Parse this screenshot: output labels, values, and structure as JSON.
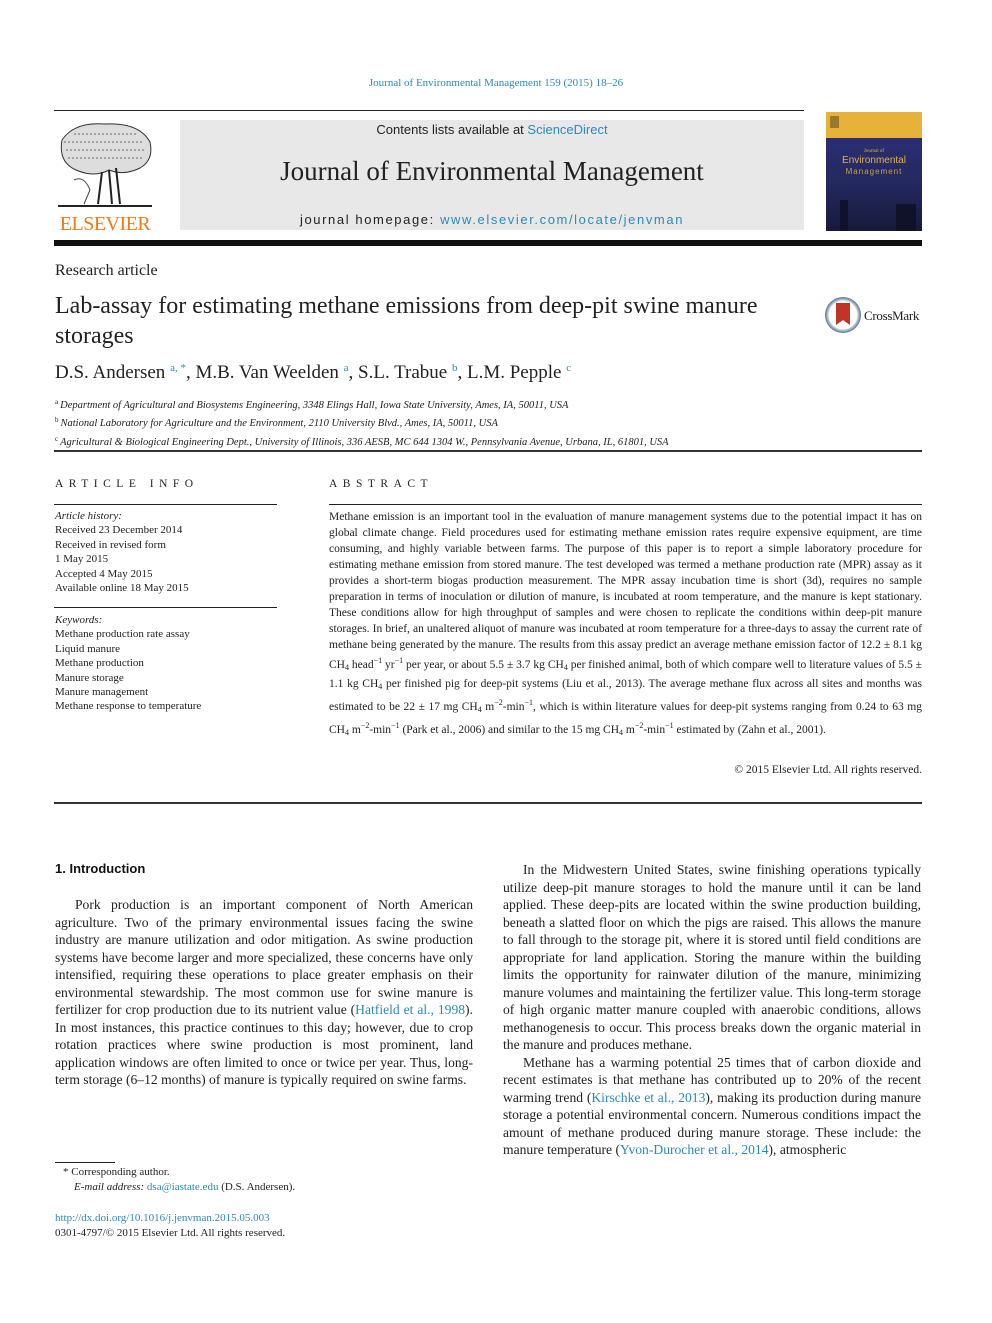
{
  "header": {
    "journal_ref": "Journal of Environmental Management 159 (2015) 18–26",
    "contents_prefix": "Contents lists available at ",
    "contents_link": "ScienceDirect",
    "journal_title": "Journal of Environmental Management",
    "homepage_prefix": "journal homepage: ",
    "homepage_link": "www.elsevier.com/locate/jenvman",
    "publisher": "ELSEVIER",
    "cover": {
      "small": "Journal of",
      "title1": "Environmental",
      "title2": "Management"
    },
    "colors": {
      "link": "#2a8ab8",
      "elsevier_orange": "#f07a16",
      "cover_gold": "#e6b23a",
      "cover_blue": "#2d3380"
    }
  },
  "article": {
    "type": "Research article",
    "title": "Lab-assay for estimating methane emissions from deep-pit swine manure storages",
    "crossmark": "CrossMark",
    "authors": [
      {
        "name": "D.S. Andersen",
        "sup": "a, *"
      },
      {
        "name": "M.B. Van Weelden",
        "sup": "a"
      },
      {
        "name": "S.L. Trabue",
        "sup": "b"
      },
      {
        "name": "L.M. Pepple",
        "sup": "c"
      }
    ],
    "affiliations": [
      {
        "sup": "a",
        "text": "Department of Agricultural and Biosystems Engineering, 3348 Elings Hall, Iowa State University, Ames, IA, 50011, USA"
      },
      {
        "sup": "b",
        "text": "National Laboratory for Agriculture and the Environment, 2110 University Blvd., Ames, IA, 50011, USA"
      },
      {
        "sup": "c",
        "text": "Agricultural & Biological Engineering Dept., University of Illinois, 336 AESB, MC 644 1304 W., Pennsylvania Avenue, Urbana, IL, 61801, USA"
      }
    ]
  },
  "article_info": {
    "heading": "ARTICLE INFO",
    "history_label": "Article history:",
    "history": [
      "Received 23 December 2014",
      "Received in revised form",
      "1 May 2015",
      "Accepted 4 May 2015",
      "Available online 18 May 2015"
    ],
    "keywords_label": "Keywords:",
    "keywords": [
      "Methane production rate assay",
      "Liquid manure",
      "Methane production",
      "Manure storage",
      "Manure management",
      "Methane response to temperature"
    ]
  },
  "abstract": {
    "heading": "ABSTRACT",
    "p1": "Methane emission is an important tool in the evaluation of manure management systems due to the potential impact it has on global climate change. Field procedures used for estimating methane emission rates require expensive equipment, are time consuming, and highly variable between farms. The purpose of this paper is to report a simple laboratory procedure for estimating methane emission from stored manure. The test developed was termed a methane production rate (MPR) assay as it provides a short-term biogas production measurement. The MPR assay incubation time is short (3d), requires no sample preparation in terms of inoculation or dilution of manure, is incubated at room temperature, and the manure is kept stationary. These conditions allow for high throughput of samples and were chosen to replicate the conditions within deep-pit manure storages. In brief, an unaltered aliquot of manure was incubated at room temperature for a three-days to assay the current rate of methane being generated by the manure. The results from this assay predict an average methane emission factor of 12.2 ± 8.1 kg CH",
    "p2": " head",
    "p3": " yr",
    "p4": " per year, or about 5.5 ± 3.7 kg CH",
    "p5": " per finished animal, both of which compare well to literature values of 5.5 ± 1.1 kg CH",
    "p6": " per finished pig for deep-pit systems (Liu et al., 2013). The average methane flux across all sites and months was estimated to be 22 ± 17 mg CH",
    "p7": " m",
    "p8": "-min",
    "p9": ", which is within literature values for deep-pit systems ranging from 0.24 to 63 mg CH",
    "p10": " m",
    "p11": "-min",
    "p12": " (Park et al., 2006) and similar to the 15 mg CH",
    "p13": " m",
    "p14": "-min",
    "p15": " estimated by (Zahn et al., 2001).",
    "sub4": "4",
    "sup_m1": "−1",
    "sup_m2": "−2",
    "copyright": "© 2015 Elsevier Ltd. All rights reserved."
  },
  "intro": {
    "heading": "1.  Introduction",
    "left_p1_a": "Pork production is an important component of North American agriculture. Two of the primary environmental issues facing the swine industry are manure utilization and odor mitigation. As swine production systems have become larger and more specialized, these concerns have only intensified, requiring these operations to place greater emphasis on their environmental stewardship. The most common use for swine manure is fertilizer for crop production due to its nutrient value (",
    "left_p1_link": "Hatfield et al., 1998",
    "left_p1_b": "). In most instances, this practice continues to this day; however, due to crop rotation practices where swine production is most prominent, land application windows are often limited to once or twice per year. Thus, long-term storage (6–12 months) of manure is typically required on swine farms.",
    "right_p1": "In the Midwestern United States, swine finishing operations typically utilize deep-pit manure storages to hold the manure until it can be land applied. These deep-pits are located within the swine production building, beneath a slatted floor on which the pigs are raised. This allows the manure to fall through to the storage pit, where it is stored until field conditions are appropriate for land application. Storing the manure within the building limits the opportunity for rainwater dilution of the manure, minimizing manure volumes and maintaining the fertilizer value. This long-term storage of high organic matter manure coupled with anaerobic conditions, allows methanogenesis to occur. This process breaks down the organic material in the manure and produces methane.",
    "right_p2_a": "Methane has a warming potential 25 times that of carbon dioxide and recent estimates is that methane has contributed up to 20% of the recent warming trend (",
    "right_p2_link1": "Kirschke et al., 2013",
    "right_p2_b": "), making its production during manure storage a potential environmental concern. Numerous conditions impact the amount of methane produced during manure storage. These include: the manure temperature (",
    "right_p2_link2": "Yvon-Durocher et al., 2014",
    "right_p2_c": "), atmospheric"
  },
  "footnote": {
    "star": "* ",
    "corresponding": "Corresponding author.",
    "email_label": "E-mail address: ",
    "email": "dsa@iastate.edu",
    "email_suffix": " (D.S. Andersen).",
    "doi": "http://dx.doi.org/10.1016/j.jenvman.2015.05.003",
    "issn": "0301-4797/© 2015 Elsevier Ltd. All rights reserved."
  }
}
